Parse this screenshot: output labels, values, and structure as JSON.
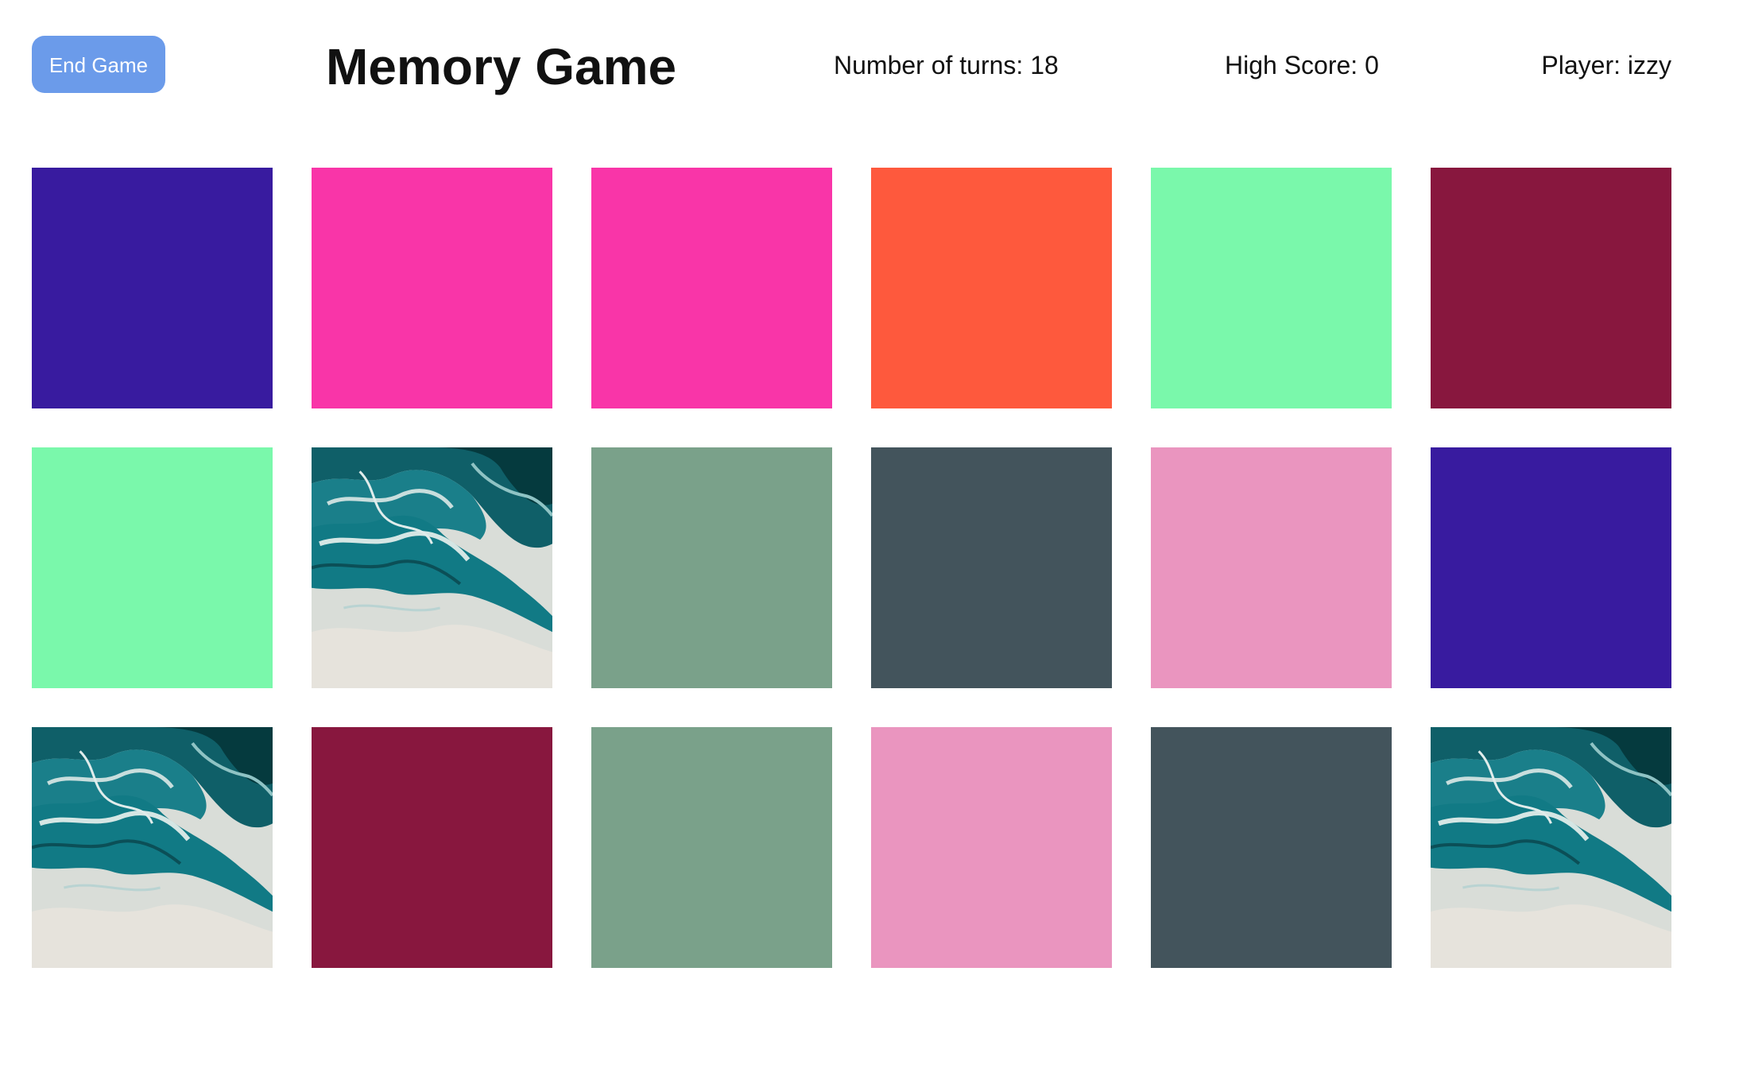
{
  "header": {
    "end_game_label": "End Game",
    "title": "Memory Game",
    "turns_text": "Number of turns: 18",
    "high_score_text": "High Score: 0",
    "player_text": "Player: izzy"
  },
  "colors": {
    "button_bg": "#6b9bea",
    "button_text": "#ffffff",
    "background": "#ffffff"
  },
  "board": {
    "columns": 6,
    "rows": 3,
    "cards": [
      {
        "kind": "color",
        "color": "#381b9f"
      },
      {
        "kind": "color",
        "color": "#f935a8"
      },
      {
        "kind": "color",
        "color": "#f935a8"
      },
      {
        "kind": "color",
        "color": "#fe593d"
      },
      {
        "kind": "color",
        "color": "#7af8ab"
      },
      {
        "kind": "color",
        "color": "#88173e"
      },
      {
        "kind": "color",
        "color": "#7af8ab"
      },
      {
        "kind": "image",
        "image": "teal-marble"
      },
      {
        "kind": "color",
        "color": "#7aa18a"
      },
      {
        "kind": "color",
        "color": "#43545c"
      },
      {
        "kind": "color",
        "color": "#ea95bf"
      },
      {
        "kind": "color",
        "color": "#381b9f"
      },
      {
        "kind": "image",
        "image": "teal-marble"
      },
      {
        "kind": "color",
        "color": "#88173e"
      },
      {
        "kind": "color",
        "color": "#7aa18a"
      },
      {
        "kind": "color",
        "color": "#ea95bf"
      },
      {
        "kind": "color",
        "color": "#43545c"
      },
      {
        "kind": "image",
        "image": "teal-marble"
      }
    ]
  }
}
